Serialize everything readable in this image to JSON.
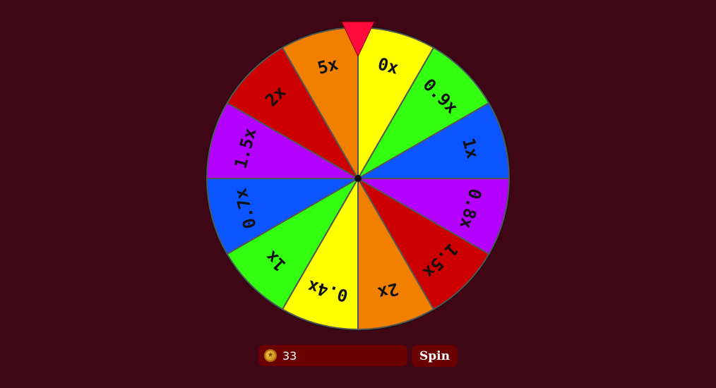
{
  "wheel": {
    "segments": [
      {
        "label": "0x",
        "color": "#ffff00"
      },
      {
        "label": "0.9x",
        "color": "#33ff11"
      },
      {
        "label": "1x",
        "color": "#0a55ff"
      },
      {
        "label": "0.8x",
        "color": "#b300ff"
      },
      {
        "label": "1.5x",
        "color": "#cc0000"
      },
      {
        "label": "2x",
        "color": "#f28000"
      },
      {
        "label": "0.4x",
        "color": "#ffff00"
      },
      {
        "label": "1x",
        "color": "#33ff11"
      },
      {
        "label": "0.7x",
        "color": "#0a55ff"
      },
      {
        "label": "1.5x",
        "color": "#b300ff"
      },
      {
        "label": "2x",
        "color": "#cc0000"
      },
      {
        "label": "5x",
        "color": "#f28000"
      }
    ],
    "pointer_color": "#ff0a3c",
    "rim_color": "#111111",
    "divider_color": "#555555"
  },
  "bet": {
    "icon": "coin-icon",
    "value": "33"
  },
  "spin": {
    "label": "Spin"
  },
  "colors": {
    "background": "#3f0616",
    "control_bg": "#6a0000"
  }
}
